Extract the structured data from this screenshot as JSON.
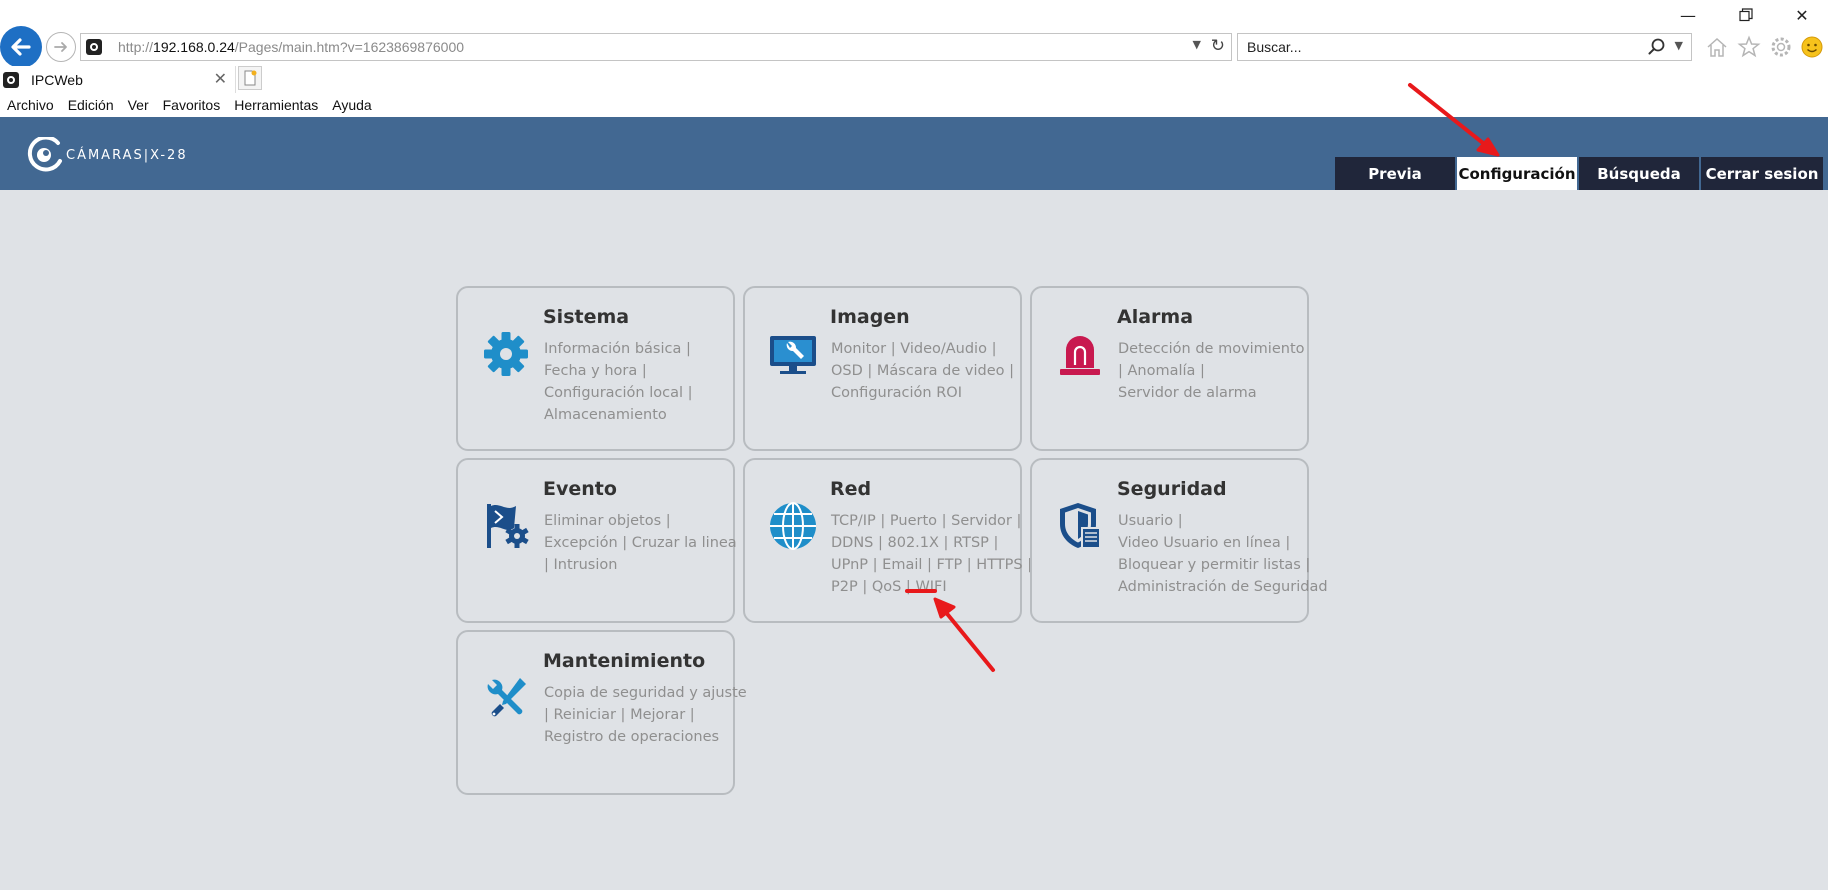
{
  "browser": {
    "url_prefix": "http://",
    "url_host": "192.168.0.24",
    "url_path": "/Pages/main.htm?v=1623869876000",
    "search_placeholder": "Buscar...",
    "tab_title": "IPCWeb"
  },
  "menu": [
    "Archivo",
    "Edición",
    "Ver",
    "Favoritos",
    "Herramientas",
    "Ayuda"
  ],
  "header": {
    "logo_text": "CÁMARAS|X-28",
    "nav": [
      {
        "label": "Previa",
        "active": false
      },
      {
        "label": "Configuración",
        "active": true
      },
      {
        "label": "Búsqueda",
        "active": false
      },
      {
        "label": "Cerrar sesion",
        "active": false
      }
    ]
  },
  "cards": {
    "sistema": {
      "title": "Sistema",
      "icon": "gear-icon",
      "lines": [
        [
          "Información básica"
        ],
        [
          "Fecha y hora"
        ],
        [
          "Configuración local"
        ],
        [
          "Almacenamiento"
        ]
      ],
      "trail": [
        true,
        true,
        true,
        false
      ]
    },
    "imagen": {
      "title": "Imagen",
      "icon": "monitor-wrench-icon",
      "lines": [
        [
          "Monitor",
          "Video/Audio"
        ],
        [
          "OSD",
          "Máscara de video"
        ],
        [
          "Configuración ROI"
        ]
      ],
      "trail": [
        true,
        true,
        false
      ]
    },
    "alarma": {
      "title": "Alarma",
      "icon": "alarm-light-icon",
      "lines": [
        [
          "Detección de movimiento"
        ],
        [
          "Anomalía"
        ],
        [
          "Servidor de alarma"
        ]
      ],
      "trail": [
        false,
        true,
        false
      ]
    },
    "evento": {
      "title": "Evento",
      "icon": "flag-gear-icon",
      "lines": [
        [
          "Eliminar objetos"
        ],
        [
          "Excepción",
          "Cruzar la linea"
        ],
        [
          "Intrusion"
        ]
      ],
      "trail": [
        true,
        false,
        false
      ]
    },
    "red": {
      "title": "Red",
      "icon": "globe-icon",
      "lines": [
        [
          "TCP/IP",
          "Puerto",
          "Servidor"
        ],
        [
          "DDNS",
          "802.1X",
          "RTSP"
        ],
        [
          "UPnP",
          "Email",
          "FTP",
          "HTTPS"
        ],
        [
          "P2P",
          "QoS",
          "WIFI"
        ]
      ],
      "trail": [
        true,
        true,
        true,
        false
      ]
    },
    "seguridad": {
      "title": "Seguridad",
      "icon": "shield-document-icon",
      "lines": [
        [
          "Usuario"
        ],
        [
          "Video Usuario en línea"
        ],
        [
          "Bloquear y permitir listas"
        ],
        [
          "Administración de Seguridad"
        ]
      ],
      "trail": [
        true,
        true,
        true,
        false
      ]
    },
    "mantenimiento": {
      "title": "Mantenimiento",
      "icon": "tools-icon",
      "lines": [
        [
          "Copia de seguridad y ajuste"
        ],
        [
          "Reiniciar",
          "Mejorar"
        ],
        [
          "Registro de operaciones"
        ]
      ],
      "trail": [
        false,
        true,
        false
      ]
    }
  },
  "colors": {
    "header_bg": "#426892",
    "nav_bg": "#20263a",
    "icon_blue": "#1f8ec9",
    "icon_navy": "#1b4e8a",
    "alarm_red": "#c8194f",
    "annotation_red": "#e8191b"
  }
}
